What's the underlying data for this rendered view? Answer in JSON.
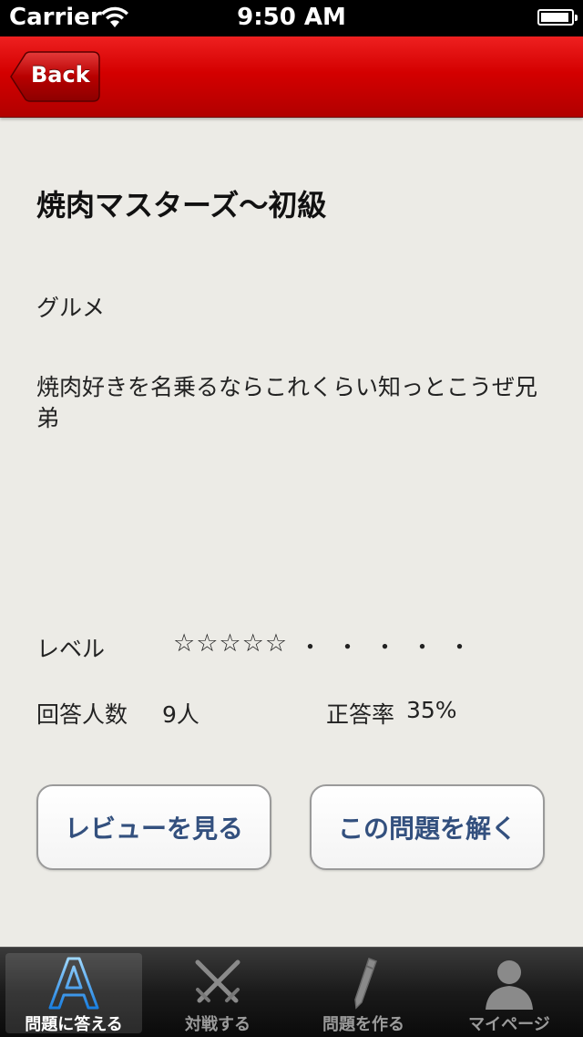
{
  "status_bar": {
    "carrier": "Carrier",
    "time": "9:50 AM"
  },
  "nav": {
    "back_label": "Back",
    "accent_color": "#d40000"
  },
  "quiz": {
    "title": "焼肉マスターズ〜初級",
    "category": "グルメ",
    "description": "焼肉好きを名乗るならこれくらい知っとこうぜ兄弟",
    "level_label": "レベル",
    "level_stars": "☆☆☆☆☆",
    "level_dots": "・・・・・",
    "answers_label": "回答人数",
    "answers_value": "9人",
    "rate_label": "正答率",
    "rate_value": "35%"
  },
  "buttons": {
    "review": "レビューを見る",
    "solve": "この問題を解く"
  },
  "tabs": [
    {
      "label": "問題に答える",
      "icon": "letter-a-icon",
      "active": true
    },
    {
      "label": "対戦する",
      "icon": "crossed-swords-icon",
      "active": false
    },
    {
      "label": "問題を作る",
      "icon": "pencil-icon",
      "active": false
    },
    {
      "label": "マイページ",
      "icon": "person-icon",
      "active": false
    }
  ]
}
